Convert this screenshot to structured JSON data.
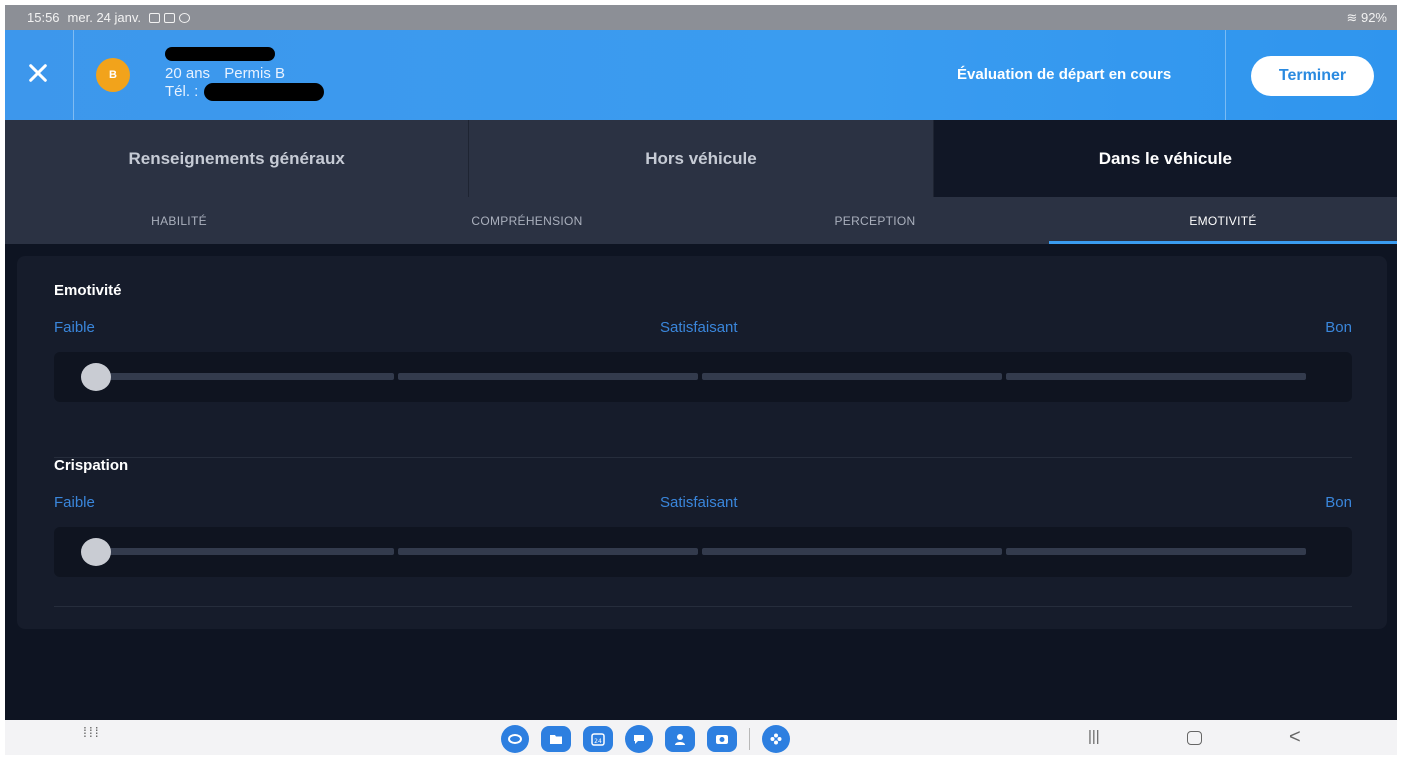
{
  "status_bar": {
    "time": "15:56",
    "date": "mer. 24 janv.",
    "battery": "92%"
  },
  "header": {
    "avatar_initial": "B",
    "age": "20 ans",
    "licence": "Permis B",
    "phone_label": "Tél. :",
    "evaluation_status": "Évaluation de départ en cours",
    "finish_button": "Terminer"
  },
  "main_tabs": [
    {
      "label": "Renseignements généraux",
      "active": false
    },
    {
      "label": "Hors véhicule",
      "active": false
    },
    {
      "label": "Dans le véhicule",
      "active": true
    }
  ],
  "sub_tabs": [
    {
      "label": "HABILITÉ",
      "active": false
    },
    {
      "label": "COMPRÉHENSION",
      "active": false
    },
    {
      "label": "PERCEPTION",
      "active": false
    },
    {
      "label": "EMOTIVITÉ",
      "active": true
    }
  ],
  "criteria": [
    {
      "title": "Emotivité",
      "scale": {
        "low": "Faible",
        "mid": "Satisfaisant",
        "high": "Bon"
      },
      "value": 0
    },
    {
      "title": "Crispation",
      "scale": {
        "low": "Faible",
        "mid": "Satisfaisant",
        "high": "Bon"
      },
      "value": 0
    }
  ],
  "colors": {
    "header_blue": "#3a9cf0",
    "accent_blue": "#3a86db",
    "avatar_orange": "#f2a31b",
    "background_dark": "#0e1422"
  },
  "icons": {
    "close": "close-icon",
    "dock": [
      "browser-icon",
      "files-icon",
      "calendar-icon",
      "messages-icon",
      "contacts-icon",
      "camera-icon",
      "flower-app-icon"
    ]
  },
  "nav": {
    "calendar_day": "24"
  }
}
